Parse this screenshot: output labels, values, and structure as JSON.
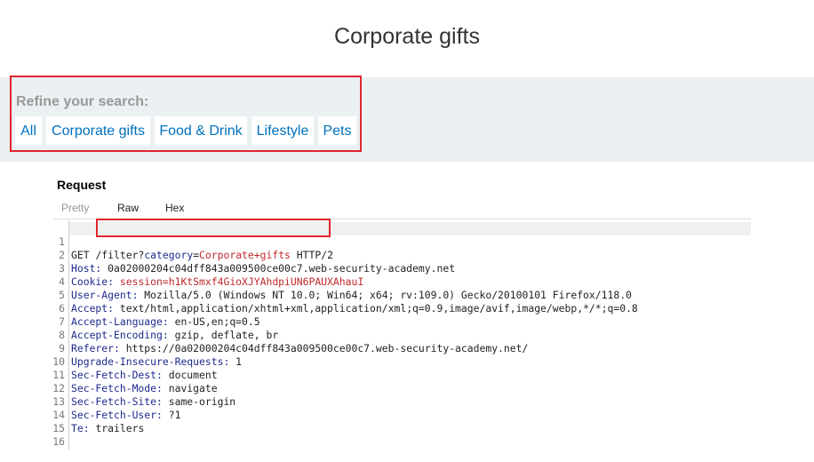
{
  "page": {
    "title": "Corporate gifts"
  },
  "filter": {
    "label": "Refine your search:",
    "buttons": [
      "All",
      "Corporate gifts",
      "Food & Drink",
      "Lifestyle",
      "Pets"
    ]
  },
  "request": {
    "title": "Request",
    "tabs": [
      "Pretty",
      "Raw",
      "Hex"
    ],
    "line1": {
      "method": "GET",
      "path": "/filter?",
      "param_name": "category",
      "equals": "=",
      "param_value": "Corporate+gifts",
      "protocol": "HTTP/2"
    },
    "headers": [
      {
        "name": "Host:",
        "value": "0a02000204c04dff843a009500ce00c7.web-security-academy.net"
      },
      {
        "name": "Cookie:",
        "value": "session=h1KtSmxf4GioXJYAhdpiUN6PAUXAhauI"
      },
      {
        "name": "User-Agent:",
        "value": "Mozilla/5.0 (Windows NT 10.0; Win64; x64; rv:109.0) Gecko/20100101 Firefox/118.0"
      },
      {
        "name": "Accept:",
        "value": "text/html,application/xhtml+xml,application/xml;q=0.9,image/avif,image/webp,*/*;q=0.8"
      },
      {
        "name": "Accept-Language:",
        "value": "en-US,en;q=0.5"
      },
      {
        "name": "Accept-Encoding:",
        "value": "gzip, deflate, br"
      },
      {
        "name": "Referer:",
        "value": "https://0a02000204c04dff843a009500ce00c7.web-security-academy.net/"
      },
      {
        "name": "Upgrade-Insecure-Requests:",
        "value": "1"
      },
      {
        "name": "Sec-Fetch-Dest:",
        "value": "document"
      },
      {
        "name": "Sec-Fetch-Mode:",
        "value": "navigate"
      },
      {
        "name": "Sec-Fetch-Site:",
        "value": "same-origin"
      },
      {
        "name": "Sec-Fetch-User:",
        "value": "?1"
      },
      {
        "name": "Te:",
        "value": "trailers"
      }
    ],
    "line_numbers": [
      "1",
      "2",
      "3",
      "4",
      "5",
      "6",
      "7",
      "8",
      "9",
      "10",
      "11",
      "12",
      "13",
      "14",
      "15",
      "16"
    ]
  },
  "colors": {
    "highlight_border": "#e0262d",
    "link": "#0071bc",
    "header_name": "#1e2a8c",
    "value_red": "#c0292b",
    "band": "#ebf0f2"
  }
}
